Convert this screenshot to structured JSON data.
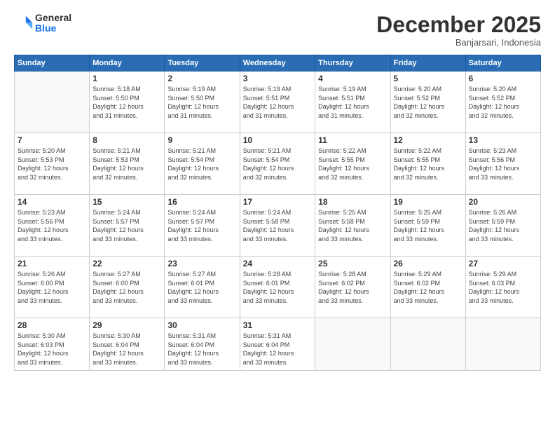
{
  "logo": {
    "general": "General",
    "blue": "Blue"
  },
  "title": "December 2025",
  "location": "Banjarsari, Indonesia",
  "headers": [
    "Sunday",
    "Monday",
    "Tuesday",
    "Wednesday",
    "Thursday",
    "Friday",
    "Saturday"
  ],
  "weeks": [
    [
      {
        "day": "",
        "info": ""
      },
      {
        "day": "1",
        "info": "Sunrise: 5:18 AM\nSunset: 5:50 PM\nDaylight: 12 hours\nand 31 minutes."
      },
      {
        "day": "2",
        "info": "Sunrise: 5:19 AM\nSunset: 5:50 PM\nDaylight: 12 hours\nand 31 minutes."
      },
      {
        "day": "3",
        "info": "Sunrise: 5:19 AM\nSunset: 5:51 PM\nDaylight: 12 hours\nand 31 minutes."
      },
      {
        "day": "4",
        "info": "Sunrise: 5:19 AM\nSunset: 5:51 PM\nDaylight: 12 hours\nand 31 minutes."
      },
      {
        "day": "5",
        "info": "Sunrise: 5:20 AM\nSunset: 5:52 PM\nDaylight: 12 hours\nand 32 minutes."
      },
      {
        "day": "6",
        "info": "Sunrise: 5:20 AM\nSunset: 5:52 PM\nDaylight: 12 hours\nand 32 minutes."
      }
    ],
    [
      {
        "day": "7",
        "info": "Sunrise: 5:20 AM\nSunset: 5:53 PM\nDaylight: 12 hours\nand 32 minutes."
      },
      {
        "day": "8",
        "info": "Sunrise: 5:21 AM\nSunset: 5:53 PM\nDaylight: 12 hours\nand 32 minutes."
      },
      {
        "day": "9",
        "info": "Sunrise: 5:21 AM\nSunset: 5:54 PM\nDaylight: 12 hours\nand 32 minutes."
      },
      {
        "day": "10",
        "info": "Sunrise: 5:21 AM\nSunset: 5:54 PM\nDaylight: 12 hours\nand 32 minutes."
      },
      {
        "day": "11",
        "info": "Sunrise: 5:22 AM\nSunset: 5:55 PM\nDaylight: 12 hours\nand 32 minutes."
      },
      {
        "day": "12",
        "info": "Sunrise: 5:22 AM\nSunset: 5:55 PM\nDaylight: 12 hours\nand 32 minutes."
      },
      {
        "day": "13",
        "info": "Sunrise: 5:23 AM\nSunset: 5:56 PM\nDaylight: 12 hours\nand 33 minutes."
      }
    ],
    [
      {
        "day": "14",
        "info": "Sunrise: 5:23 AM\nSunset: 5:56 PM\nDaylight: 12 hours\nand 33 minutes."
      },
      {
        "day": "15",
        "info": "Sunrise: 5:24 AM\nSunset: 5:57 PM\nDaylight: 12 hours\nand 33 minutes."
      },
      {
        "day": "16",
        "info": "Sunrise: 5:24 AM\nSunset: 5:57 PM\nDaylight: 12 hours\nand 33 minutes."
      },
      {
        "day": "17",
        "info": "Sunrise: 5:24 AM\nSunset: 5:58 PM\nDaylight: 12 hours\nand 33 minutes."
      },
      {
        "day": "18",
        "info": "Sunrise: 5:25 AM\nSunset: 5:58 PM\nDaylight: 12 hours\nand 33 minutes."
      },
      {
        "day": "19",
        "info": "Sunrise: 5:25 AM\nSunset: 5:59 PM\nDaylight: 12 hours\nand 33 minutes."
      },
      {
        "day": "20",
        "info": "Sunrise: 5:26 AM\nSunset: 5:59 PM\nDaylight: 12 hours\nand 33 minutes."
      }
    ],
    [
      {
        "day": "21",
        "info": "Sunrise: 5:26 AM\nSunset: 6:00 PM\nDaylight: 12 hours\nand 33 minutes."
      },
      {
        "day": "22",
        "info": "Sunrise: 5:27 AM\nSunset: 6:00 PM\nDaylight: 12 hours\nand 33 minutes."
      },
      {
        "day": "23",
        "info": "Sunrise: 5:27 AM\nSunset: 6:01 PM\nDaylight: 12 hours\nand 33 minutes."
      },
      {
        "day": "24",
        "info": "Sunrise: 5:28 AM\nSunset: 6:01 PM\nDaylight: 12 hours\nand 33 minutes."
      },
      {
        "day": "25",
        "info": "Sunrise: 5:28 AM\nSunset: 6:02 PM\nDaylight: 12 hours\nand 33 minutes."
      },
      {
        "day": "26",
        "info": "Sunrise: 5:29 AM\nSunset: 6:02 PM\nDaylight: 12 hours\nand 33 minutes."
      },
      {
        "day": "27",
        "info": "Sunrise: 5:29 AM\nSunset: 6:03 PM\nDaylight: 12 hours\nand 33 minutes."
      }
    ],
    [
      {
        "day": "28",
        "info": "Sunrise: 5:30 AM\nSunset: 6:03 PM\nDaylight: 12 hours\nand 33 minutes."
      },
      {
        "day": "29",
        "info": "Sunrise: 5:30 AM\nSunset: 6:04 PM\nDaylight: 12 hours\nand 33 minutes."
      },
      {
        "day": "30",
        "info": "Sunrise: 5:31 AM\nSunset: 6:04 PM\nDaylight: 12 hours\nand 33 minutes."
      },
      {
        "day": "31",
        "info": "Sunrise: 5:31 AM\nSunset: 6:04 PM\nDaylight: 12 hours\nand 33 minutes."
      },
      {
        "day": "",
        "info": ""
      },
      {
        "day": "",
        "info": ""
      },
      {
        "day": "",
        "info": ""
      }
    ]
  ]
}
